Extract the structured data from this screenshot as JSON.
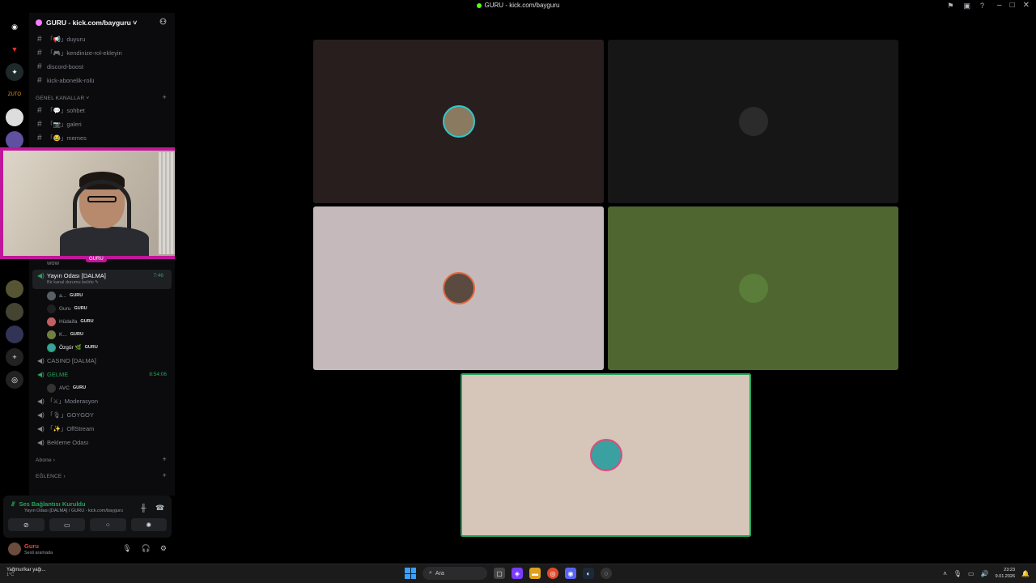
{
  "window": {
    "title": "GURU - kick.com/bayguru"
  },
  "server": {
    "name": "GURU - kick.com/bayguru ˅"
  },
  "channels": {
    "top": [
      {
        "icon": "#",
        "label": "「📢」duyuru"
      },
      {
        "icon": "#",
        "label": "「🎮」kendinize-rol-ekleyin"
      },
      {
        "icon": "#",
        "label": "discord-boost"
      },
      {
        "icon": "#",
        "label": "kick-abonelik-rolü"
      }
    ],
    "general_category": "GENEL KANALLAR ˅",
    "general": [
      {
        "icon": "#",
        "label": "「💬」sohbet"
      },
      {
        "icon": "#",
        "label": "「📷」galeri"
      },
      {
        "icon": "#",
        "label": "「😂」memes"
      }
    ],
    "hidden_under_cam": "wow",
    "active_voice": {
      "label": "Yayın Odası [DALMA]",
      "time": "7:46",
      "sub": "Bir kanal durumu belirle ✎"
    },
    "active_members": [
      {
        "name": "a...",
        "tag": "GURU"
      },
      {
        "name": "Guru",
        "tag": "GURU"
      },
      {
        "name": "Hüdaifa",
        "tag": "GURU"
      },
      {
        "name": "K...",
        "tag": "GURU"
      },
      {
        "name": "Özgür 🌿",
        "tag": "GURU"
      }
    ],
    "casino": "CASINO [DALMA]",
    "gelme": {
      "label": "GELME",
      "time": "8:54:06"
    },
    "gelme_members": [
      {
        "name": "AVC",
        "tag": "GURU"
      }
    ],
    "more_voice": [
      "「⚔」Moderasyon",
      "「🎙」GOYGOY",
      "「✨」OffStream",
      "Bekleme Odası"
    ],
    "abone_category": "Abone ›",
    "eglence_category": "EĞLENCE ›"
  },
  "webcam": {
    "label": "GURU"
  },
  "voice_connection": {
    "status": "Ses Bağlantısı Kuruldu",
    "sub": "Yayın Odası [DALMA] / GURU - kick.com/bayguru"
  },
  "user": {
    "name": "Guru",
    "status": "Sesli aramada"
  },
  "tiles": [
    {
      "color": "#281e1e",
      "avatar_color": "#8a7a60",
      "ring": "#34c7c7"
    },
    {
      "color": "#161617",
      "avatar_color": "#2b2b2b",
      "ring": "#161617"
    },
    {
      "color": "#c5b9bb",
      "avatar_color": "#5a4a40",
      "ring": "#e06a3a"
    },
    {
      "color": "#4f6630",
      "avatar_color": "#5a7d3a",
      "ring": "#4f6630"
    },
    {
      "color": "#d6c6ba",
      "avatar_color": "#3aa0a0",
      "ring": "#e04a7a"
    }
  ],
  "taskbar": {
    "weather_title": "Yağmur/kar yağı...",
    "weather_temp": "1°C",
    "search": "Ara",
    "time": "23:23",
    "date": "9.01.2026"
  },
  "colors": {
    "accent_green": "#23a55a",
    "cam_border": "#c0179a",
    "kick_green": "#53fc18"
  }
}
